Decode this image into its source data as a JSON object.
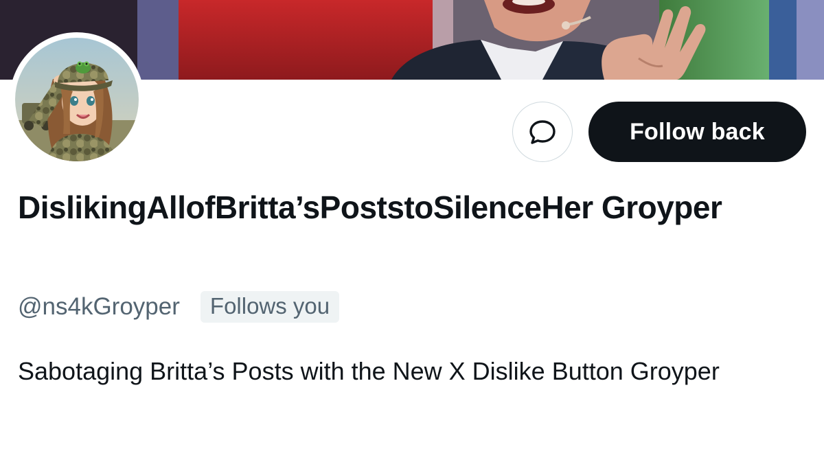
{
  "profile": {
    "display_name": "DislikingAllofBritta’sPoststoSilenceHer Groyper",
    "handle": "@ns4kGroyper",
    "follows_you_badge": "Follows you",
    "bio": "Sabotaging Britta’s Posts with the New X Dislike Button Groyper"
  },
  "actions": {
    "follow_label": "Follow back",
    "message_icon": "message-bubble-icon"
  },
  "colors": {
    "text_primary": "#0f1419",
    "text_secondary": "#536471",
    "button_dark": "#0f1419",
    "badge_bg": "#eff3f4",
    "border": "#cfd9de"
  }
}
